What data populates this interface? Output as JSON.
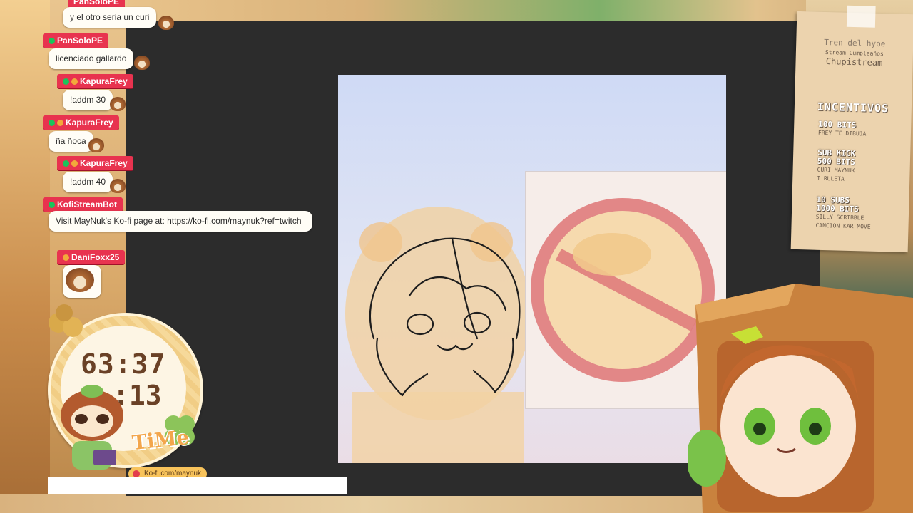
{
  "chat": {
    "messages": [
      {
        "user": "PanSoloPE",
        "text": "y el otro seria un curi"
      },
      {
        "user": "PanSoloPE",
        "text": "licenciado gallardo"
      },
      {
        "user": "KapuraFrey",
        "text": "!addm 30"
      },
      {
        "user": "KapuraFrey",
        "text": "ña ñoca"
      },
      {
        "user": "KapuraFrey",
        "text": "!addm 40"
      },
      {
        "user": "KofiStreamBot",
        "text": "Visit MayNuk's Ko-fi page at: https://ko-fi.com/maynuk?ref=twitch"
      },
      {
        "user": "DaniFoxx25",
        "text": ""
      }
    ],
    "badge_color": "#e8334f"
  },
  "timer": {
    "line1": "63:37",
    "line2": ":13",
    "word": "TiMe",
    "kofi_link": "Ko-fi.com/maynuk"
  },
  "card": {
    "title1": "Tren del hype",
    "title2": "Stream Cumpleaños",
    "title3": "Chupistream",
    "heading": "INCENTIVOS",
    "items": [
      {
        "amount": "100 BITS",
        "desc": "FREY TE DIBUJA"
      },
      {
        "amount": "SUB KICK",
        "amount2": "500 BITS",
        "desc": "CURI MAYNUK",
        "desc2": "I RULETA"
      },
      {
        "amount": "10 SUBS",
        "amount2": "1000 BITS",
        "desc": "SILLY SCRIBBLE",
        "desc2": "CANCION KAR MOVE"
      }
    ]
  },
  "icons": {
    "emote": "raccoon-emote-icon",
    "kofi": "heart-icon",
    "mascot": "raccoon-mascot-icon"
  }
}
